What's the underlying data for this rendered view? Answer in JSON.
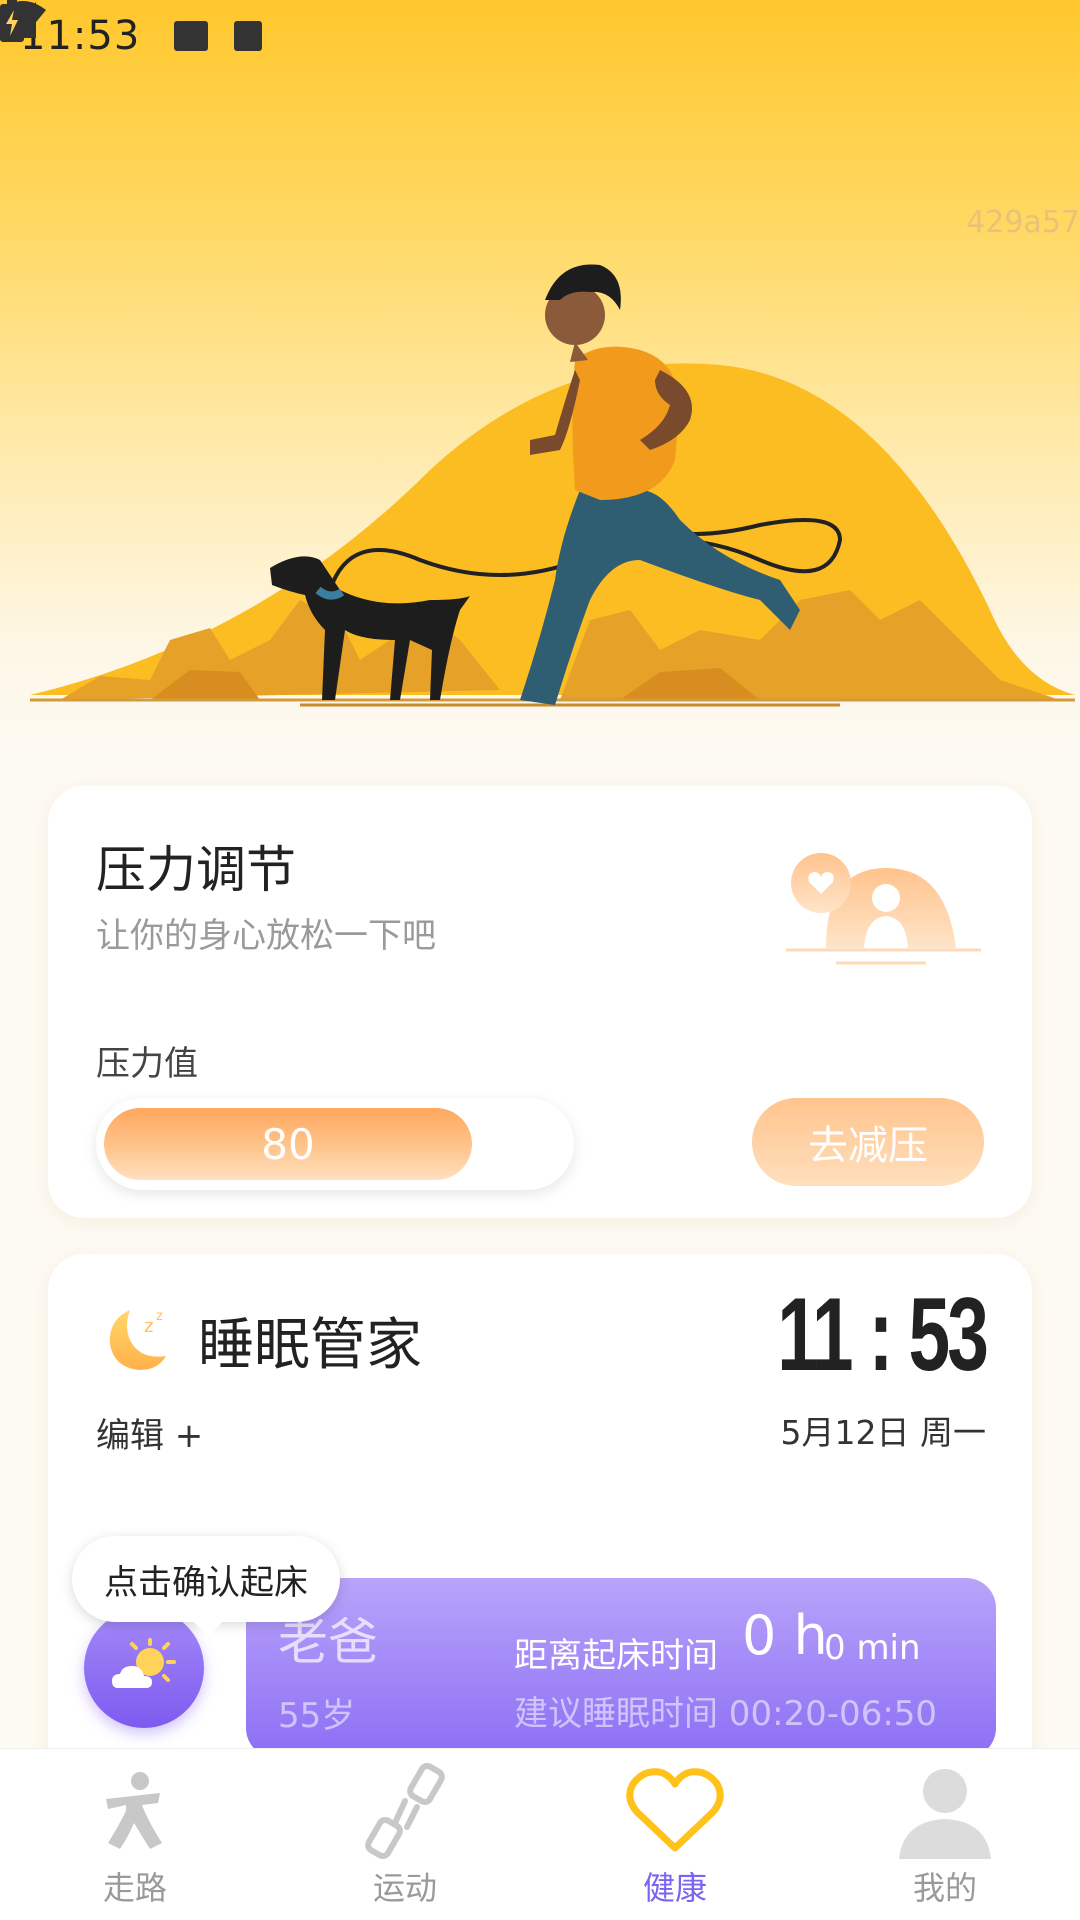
{
  "status_bar": {
    "time": "11:53"
  },
  "hero": {
    "hash": "429a57"
  },
  "stress": {
    "title": "压力调节",
    "subtitle": "让你的身心放松一下吧",
    "label": "压力值",
    "value": "80",
    "level": 0.8,
    "button": "去减压"
  },
  "sleep": {
    "title": "睡眠管家",
    "edit": "编辑 +",
    "clock": "11 : 53",
    "date": "5月12日 周一",
    "tooltip": "点击确认起床",
    "person": {
      "name": "老爸",
      "age": "55岁",
      "wake_label": "距离起床时间",
      "wake_h": "0 h",
      "wake_min": "0 min",
      "suggest": "建议睡眠时间 00:20-06:50"
    }
  },
  "tabs": [
    {
      "label": "走路",
      "icon": "walk-icon"
    },
    {
      "label": "运动",
      "icon": "dumbbell-icon"
    },
    {
      "label": "健康",
      "icon": "heart-icon"
    },
    {
      "label": "我的",
      "icon": "profile-icon"
    }
  ],
  "colors": {
    "accent": "#7b64f0",
    "hero_yellow": "#ffc72c",
    "orange": "#ffa75d",
    "heart": "#ffc21a"
  }
}
